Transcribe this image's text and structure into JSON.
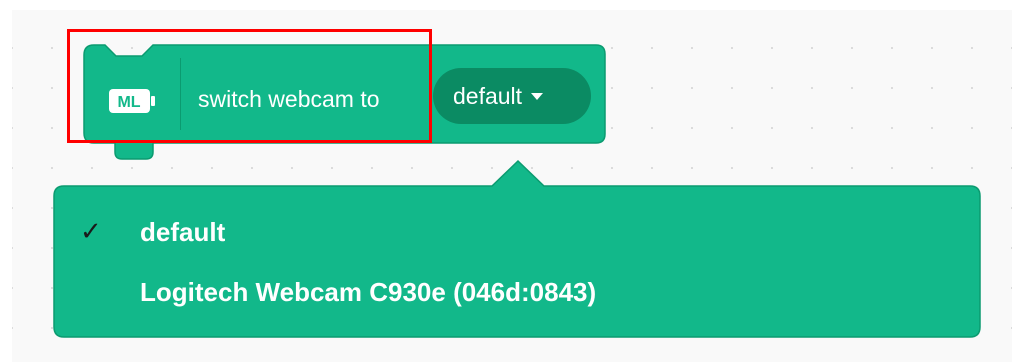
{
  "block": {
    "icon": "ml-extension-icon",
    "icon_text": "ML",
    "text": "switch webcam to",
    "dropdown_value": "default",
    "dropdown_arrow_icon": "caret-down-icon"
  },
  "menu": {
    "items": [
      {
        "label": "default",
        "selected": true,
        "check_icon": "checkmark-icon",
        "check_glyph": "✓"
      },
      {
        "label": "Logitech Webcam C930e (046d:0843)",
        "selected": false
      }
    ]
  },
  "colors": {
    "block_fill": "#12b88a",
    "block_stroke": "#0b9b70",
    "dropdown_fill": "#0b8b63",
    "menu_fill": "#12b88a",
    "highlight": "#ff0000",
    "workspace": "#f9f9f9"
  }
}
